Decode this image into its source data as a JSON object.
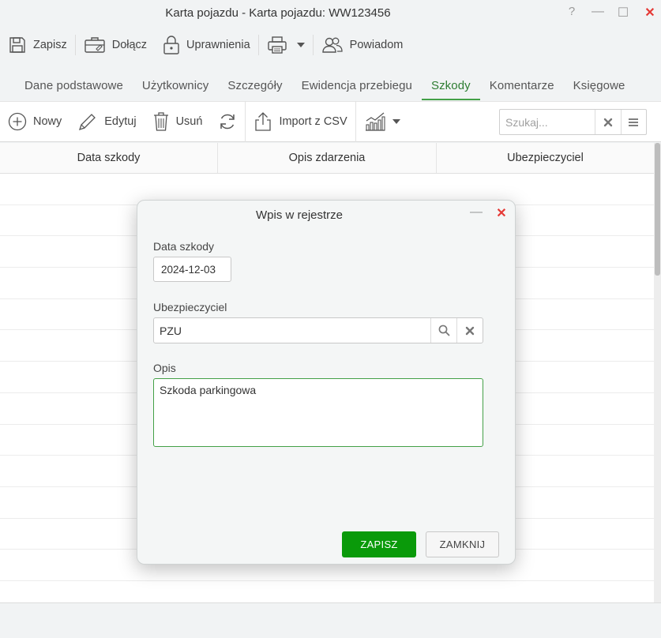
{
  "window": {
    "title": "Karta pojazdu - Karta pojazdu: WW123456",
    "help": "?",
    "minimize": "—",
    "maximize": "☐",
    "close": "✕"
  },
  "toolbar": {
    "save": "Zapisz",
    "attach": "Dołącz",
    "permissions": "Uprawnienia",
    "notify": "Powiadom"
  },
  "tabs": [
    {
      "label": "Dane podstawowe",
      "active": false
    },
    {
      "label": "Użytkownicy",
      "active": false
    },
    {
      "label": "Szczegóły",
      "active": false
    },
    {
      "label": "Ewidencja przebiegu",
      "active": false
    },
    {
      "label": "Szkody",
      "active": true
    },
    {
      "label": "Komentarze",
      "active": false
    },
    {
      "label": "Księgowe",
      "active": false
    }
  ],
  "actionbar": {
    "new": "Nowy",
    "edit": "Edytuj",
    "delete": "Usuń",
    "import": "Import z CSV",
    "search_placeholder": "Szukaj..."
  },
  "grid": {
    "columns": [
      "Data szkody",
      "Opis zdarzenia",
      "Ubezpieczyciel"
    ]
  },
  "dialog": {
    "title": "Wpis w rejestrze",
    "minimize": "—",
    "close": "✕",
    "date_label": "Data szkody",
    "date_value": "2024-12-03",
    "insurer_label": "Ubezpieczyciel",
    "insurer_value": "PZU",
    "description_label": "Opis",
    "description_value": "Szkoda parkingowa",
    "save_button": "ZAPISZ",
    "close_button": "ZAMKNIJ"
  },
  "colors": {
    "accent_green": "#0a9a0a",
    "tab_active": "#2e7d32",
    "close_red": "#e53935"
  }
}
